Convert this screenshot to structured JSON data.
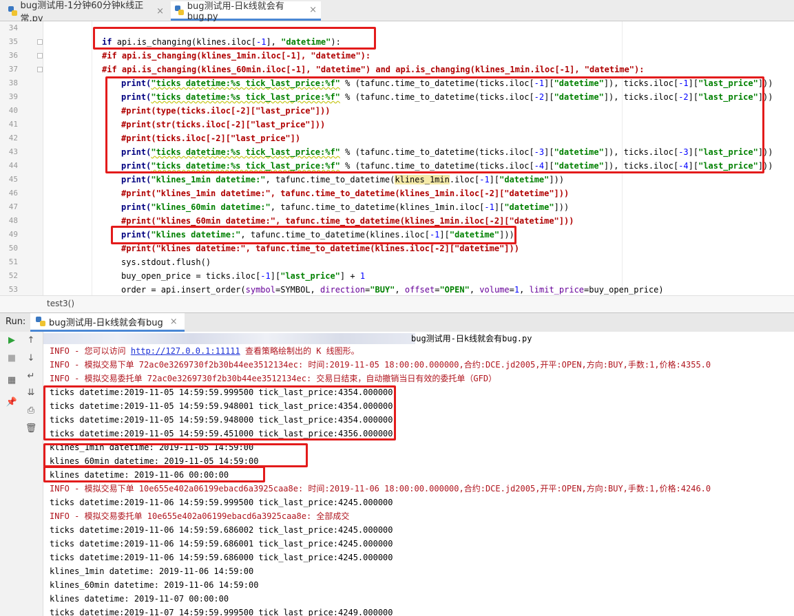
{
  "tabs": [
    {
      "label": "bug测试用-1分钟60分钟k线正常.py",
      "active": false
    },
    {
      "label": "bug测试用-日k线就会有bug.py",
      "active": true
    }
  ],
  "line_numbers": [
    "34",
    "35",
    "36",
    "37",
    "38",
    "39",
    "40",
    "41",
    "42",
    "43",
    "44",
    "45",
    "46",
    "47",
    "48",
    "49",
    "50",
    "51",
    "52",
    "53"
  ],
  "code": {
    "l35_a": "if ",
    "l35_b": "api.is_changing(klines.iloc[",
    "l35_c": "-1",
    "l35_d": "], ",
    "l35_e": "\"datetime\"",
    "l35_f": "):",
    "l36": "#if api.is_changing(klines_1min.iloc[-1], \"datetime\"):",
    "l37": "#if api.is_changing(klines_60min.iloc[-1], \"datetime\") and api.is_changing(klines_1min.iloc[-1], \"datetime\"):",
    "l38_a": "print(",
    "l38_b": "\"ticks datetime:%s tick_last_price:%f\"",
    "l38_c": " % (tafunc.time_to_datetime(ticks.iloc[",
    "l38_d": "-1",
    "l38_e": "][",
    "l38_f": "\"datetime\"",
    "l38_g": "]), ticks.iloc[",
    "l38_h": "-1",
    "l38_i": "][",
    "l38_j": "\"last_price\"",
    "l38_k": "]))",
    "l39_a": "print(",
    "l39_b": "\"ticks datetime:%s tick_last_price:%f\"",
    "l39_c": " % (tafunc.time_to_datetime(ticks.iloc[",
    "l39_d": "-2",
    "l39_e": "][",
    "l39_f": "\"datetime\"",
    "l39_g": "]), ticks.iloc[",
    "l39_h": "-2",
    "l39_i": "][",
    "l39_j": "\"last_price\"",
    "l39_k": "]))",
    "l40": "#print(type(ticks.iloc[-2][\"last_price\"]))",
    "l41": "#print(str(ticks.iloc[-2][\"last_price\"]))",
    "l42": "#print(ticks.iloc[-2][\"last_price\"])",
    "l43_a": "print(",
    "l43_b": "\"ticks datetime:%s tick_last_price:%f\"",
    "l43_c": " % (tafunc.time_to_datetime(ticks.iloc[",
    "l43_d": "-3",
    "l43_e": "][",
    "l43_f": "\"datetime\"",
    "l43_g": "]), ticks.iloc[",
    "l43_h": "-3",
    "l43_i": "][",
    "l43_j": "\"last_price\"",
    "l43_k": "]))",
    "l44_a": "print(",
    "l44_b": "\"ticks datetime:%s tick_last_price:%f\"",
    "l44_c": " % (tafunc.time_to_datetime(ticks.iloc[",
    "l44_d": "-4",
    "l44_e": "][",
    "l44_f": "\"datetime\"",
    "l44_g": "]), ticks.iloc[",
    "l44_h": "-4",
    "l44_i": "][",
    "l44_j": "\"last_price\"",
    "l44_k": "]))",
    "l45_a": "print(",
    "l45_b": "\"klines_1min datetime:\"",
    "l45_c": ", tafunc.time_to_datetime(",
    "l45_d": "klines_1min",
    "l45_e": ".iloc[",
    "l45_f": "-1",
    "l45_g": "][",
    "l45_h": "\"datetime\"",
    "l45_i": "]))",
    "l46": "#print(\"klines_1min datetime:\", tafunc.time_to_datetime(klines_1min.iloc[-2][\"datetime\"]))",
    "l47_a": "print(",
    "l47_b": "\"klines_60min datetime:\"",
    "l47_c": ", tafunc.time_to_datetime(klines_1min.iloc[",
    "l47_d": "-1",
    "l47_e": "][",
    "l47_f": "\"datetime\"",
    "l47_g": "]))",
    "l48": "#print(\"klines_60min datetime:\", tafunc.time_to_datetime(klines_1min.iloc[-2][\"datetime\"]))",
    "l49_a": "print(",
    "l49_b": "\"klines datetime:\"",
    "l49_c": ", tafunc.time_to_datetime(klines.iloc[",
    "l49_d": "-1",
    "l49_e": "][",
    "l49_f": "\"datetime\"",
    "l49_g": "]))",
    "l50": "#print(\"klines datetime:\", tafunc.time_to_datetime(klines.iloc[-2][\"datetime\"]))",
    "l51": "sys.stdout.flush()",
    "l52_a": "buy_open_price = ticks.iloc[",
    "l52_b": "-1",
    "l52_c": "][",
    "l52_d": "\"last_price\"",
    "l52_e": "] + ",
    "l52_f": "1",
    "l53_a": "order = api.insert_order(",
    "l53_b": "symbol",
    "l53_c": "=SYMBOL, ",
    "l53_d": "direction",
    "l53_e": "=",
    "l53_f": "\"BUY\"",
    "l53_g": ", ",
    "l53_h": "offset",
    "l53_i": "=",
    "l53_j": "\"OPEN\"",
    "l53_k": ", ",
    "l53_l": "volume",
    "l53_m": "=",
    "l53_n": "1",
    "l53_o": ", ",
    "l53_p": "limit_price",
    "l53_q": "=buy_open_price)"
  },
  "breadcrumb": "test3()",
  "run": {
    "label": "Run:",
    "tab_label": "bug测试用-日k线就会有bug",
    "path_tail": "bug测试用-日k线就会有bug.py"
  },
  "console": {
    "l2_a": "INFO - 您可以访问 ",
    "l2_link": "http://127.0.0.1:11111",
    "l2_b": " 查看策略绘制出的 K 线图形。",
    "l3": "INFO - 模拟交易下单 72ac0e3269730f2b30b44ee3512134ec: 时间:2019-11-05 18:00:00.000000,合约:DCE.jd2005,开平:OPEN,方向:BUY,手数:1,价格:4355.0",
    "l4": "INFO - 模拟交易委托单 72ac0e3269730f2b30b44ee3512134ec: 交易日结束，自动撤销当日有效的委托单（GFD）",
    "l5": "ticks datetime:2019-11-05 14:59:59.999500 tick_last_price:4354.000000",
    "l6": "ticks datetime:2019-11-05 14:59:59.948001 tick_last_price:4354.000000",
    "l7": "ticks datetime:2019-11-05 14:59:59.948000 tick_last_price:4354.000000",
    "l8": "ticks datetime:2019-11-05 14:59:59.451000 tick_last_price:4356.000000",
    "l9": "klines_1min datetime: 2019-11-05 14:59:00",
    "l10": "klines_60min datetime: 2019-11-05 14:59:00",
    "l11": "klines datetime: 2019-11-06 00:00:00",
    "l12": "INFO - 模拟交易下单 10e655e402a06199ebacd6a3925caa8e: 时间:2019-11-06 18:00:00.000000,合约:DCE.jd2005,开平:OPEN,方向:BUY,手数:1,价格:4246.0",
    "l13": "ticks datetime:2019-11-06 14:59:59.999500 tick_last_price:4245.000000",
    "l14": "INFO - 模拟交易委托单 10e655e402a06199ebacd6a3925caa8e: 全部成交",
    "l15": "ticks datetime:2019-11-06 14:59:59.686002 tick_last_price:4245.000000",
    "l16": "ticks datetime:2019-11-06 14:59:59.686001 tick_last_price:4245.000000",
    "l17": "ticks datetime:2019-11-06 14:59:59.686000 tick_last_price:4245.000000",
    "l18": "klines_1min datetime: 2019-11-06 14:59:00",
    "l19": "klines_60min datetime: 2019-11-06 14:59:00",
    "l20": "klines datetime: 2019-11-07 00:00:00",
    "l21": "ticks datetime:2019-11-07 14:59:59.999500 tick_last_price:4249.000000"
  },
  "toolbar_icons": [
    "run-icon",
    "stop-icon",
    "layout-icon",
    "pin-icon",
    "scroll-up-icon",
    "scroll-down-icon",
    "soft-wrap-icon",
    "scroll-to-end-icon",
    "print-icon",
    "trash-icon"
  ],
  "colors": {
    "highlight_border": "#e31b1b",
    "info_text": "#b0151e",
    "string": "#008000",
    "keyword": "#000080"
  }
}
